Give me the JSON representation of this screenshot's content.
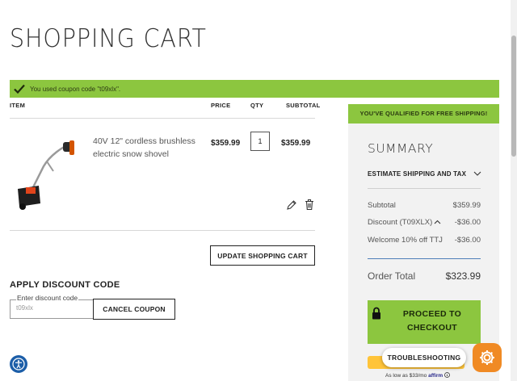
{
  "page": {
    "title": "SHOPPING CART"
  },
  "notice": {
    "text": "You used coupon code \"t09xlx\"."
  },
  "table": {
    "headers": {
      "item": "ITEM",
      "price": "PRICE",
      "qty": "QTY",
      "subtotal": "SUBTOTAL"
    },
    "rows": [
      {
        "name": "40V 12\" cordless brushless electric snow shovel",
        "price": "$359.99",
        "qty": "1",
        "subtotal": "$359.99"
      }
    ]
  },
  "actions": {
    "update_cart": "UPDATE SHOPPING CART"
  },
  "discount": {
    "title": "APPLY DISCOUNT CODE",
    "field_label": "Enter discount code",
    "value": "t09xlx",
    "cancel_label": "CANCEL COUPON"
  },
  "summary": {
    "shipping_banner": "YOU'VE QUALIFIED FOR FREE SHIPPING!",
    "title": "SUMMARY",
    "estimate_label": "ESTIMATE SHIPPING AND TAX",
    "lines": [
      {
        "label": "Subtotal",
        "value": "$359.99"
      },
      {
        "label": "Discount (T09XLX)",
        "value": "-$36.00"
      },
      {
        "label": "Welcome 10% off TTJ",
        "value": "-$36.00"
      }
    ],
    "order_total_label": "Order Total",
    "order_total_value": "$323.99",
    "checkout_line1": "PROCEED TO",
    "checkout_line2": "CHECKOUT",
    "affirm_prefix": "As low as $33/mo",
    "affirm_brand": "affirm"
  },
  "widgets": {
    "troubleshooting": "TROUBLESHOOTING"
  },
  "colors": {
    "accent_green": "#8cc63f",
    "widget_orange": "#f08a24",
    "accessibility_blue": "#1c5ea8"
  },
  "icons": [
    "check-icon",
    "edit-icon",
    "trash-icon",
    "chevron-down-icon",
    "chevron-up-icon",
    "lock-icon",
    "gear-icon",
    "accessibility-icon",
    "info-icon"
  ]
}
